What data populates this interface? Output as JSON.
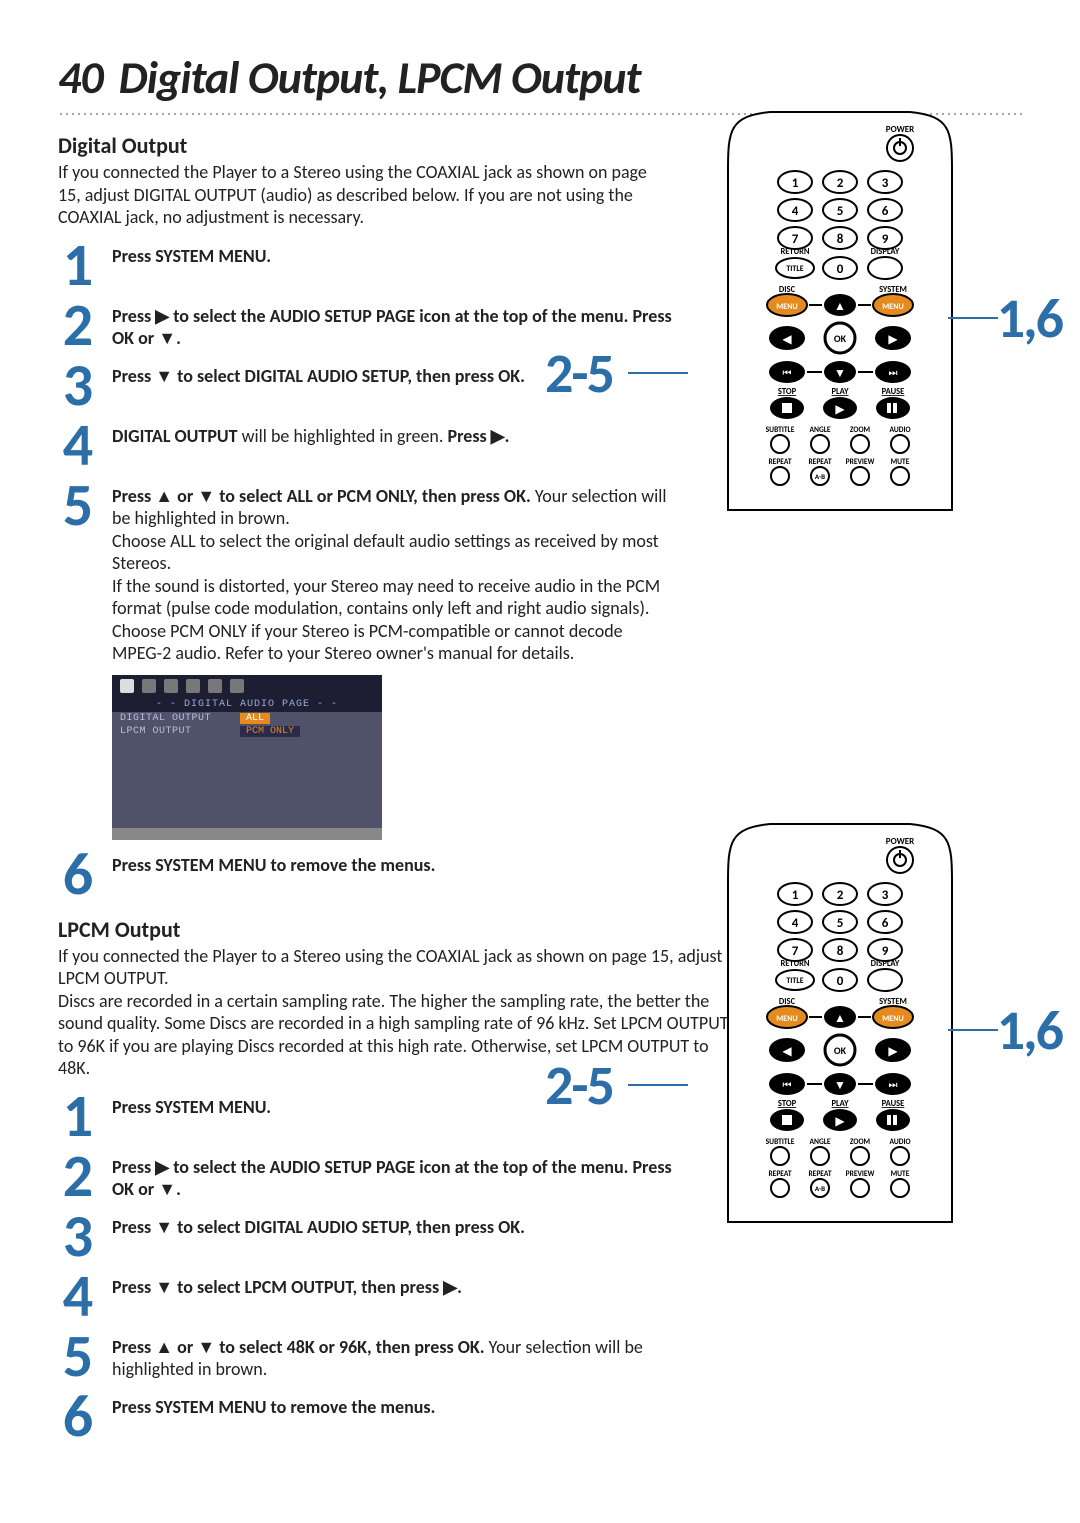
{
  "page_number": "40",
  "page_title": "Digital Output, LPCM Output",
  "digital_output": {
    "heading": "Digital Output",
    "intro": "If you connected the Player to a Stereo using the COAXIAL jack as shown on page 15, adjust DIGITAL OUTPUT (audio) as described below. If you are not using the COAXIAL jack, no adjustment is necessary.",
    "step1": "Press SYSTEM MENU.",
    "step2a": "Press ",
    "step2b": " to select the AUDIO SETUP PAGE icon at the top of the menu.  Press OK or ",
    "step2c": ".",
    "step3a": "Press ",
    "step3b": " to select DIGITAL AUDIO SETUP, then press OK.",
    "step4a": "DIGITAL OUTPUT",
    "step4b": " will be highlighted in green. ",
    "step4c": "Press ",
    "step4d": ".",
    "step5a": "Press ",
    "step5b": " or ",
    "step5c": " to select  ALL or PCM ONLY, then press OK.",
    "step5d": " Your selection will be highlighted in brown.",
    "step5e": "Choose ALL to select the original default audio settings as received by most Stereos.",
    "step5f": "If the sound is distorted, your Stereo may need to receive audio in the PCM format (pulse code modulation, contains only left and right audio signals). Choose PCM ONLY if your Stereo is PCM-compatible or cannot decode MPEG-2 audio. Refer to your Stereo owner's manual for details.",
    "step6": "Press SYSTEM MENU to remove the menus."
  },
  "osd": {
    "band": "- - DIGITAL AUDIO PAGE - -",
    "row1_label": "DIGITAL OUTPUT",
    "row1_val": "ALL",
    "row2_label": "LPCM OUTPUT",
    "row2_val": "PCM ONLY"
  },
  "lpcm_output": {
    "heading": "LPCM Output",
    "intro": "If you connected the Player to a Stereo using the COAXIAL jack as shown on page 15, adjust LPCM OUTPUT.\nDiscs are recorded in a certain sampling rate.  The higher the sampling rate, the better the sound quality.  Some Discs are recorded in a high sampling rate of 96 kHz.  Set LPCM OUTPUT to 96K if you are playing Discs recorded at this high rate. Otherwise, set LPCM OUTPUT to 48K.",
    "step1": "Press SYSTEM MENU.",
    "step2a": "Press ",
    "step2b": " to select the AUDIO SETUP PAGE icon at the top of the menu.  Press OK or ",
    "step2c": ".",
    "step3a": "Press ",
    "step3b": " to select DIGITAL AUDIO SETUP, then press OK.",
    "step4a": "Press ",
    "step4b": " to select LPCM OUTPUT, then press ",
    "step4c": ".",
    "step5a": "Press ",
    "step5b": " or ",
    "step5c": " to select 48K or 96K, then press OK.",
    "step5d": " Your selection will be highlighted in brown.",
    "step6": "Press SYSTEM MENU to remove the menus."
  },
  "remote": {
    "power": "POWER",
    "return": "RETURN",
    "display": "DISPLAY",
    "title": "TITLE",
    "disc": "DISC",
    "system": "SYSTEM",
    "menu": "MENU",
    "ok": "OK",
    "stop": "STOP",
    "play": "PLAY",
    "pause": "PAUSE",
    "subtitle": "SUBTITLE",
    "angle": "ANGLE",
    "zoom": "ZOOM",
    "audio": "AUDIO",
    "repeat": "REPEAT",
    "repeat_ab": "REPEAT",
    "ab": "A-B",
    "preview": "PREVIEW",
    "mute": "MUTE",
    "n1": "1",
    "n2": "2",
    "n3": "3",
    "n4": "4",
    "n5": "5",
    "n6": "6",
    "n7": "7",
    "n8": "8",
    "n9": "9",
    "n0": "0",
    "callout_left": "2-5",
    "callout_right": "1,6"
  }
}
